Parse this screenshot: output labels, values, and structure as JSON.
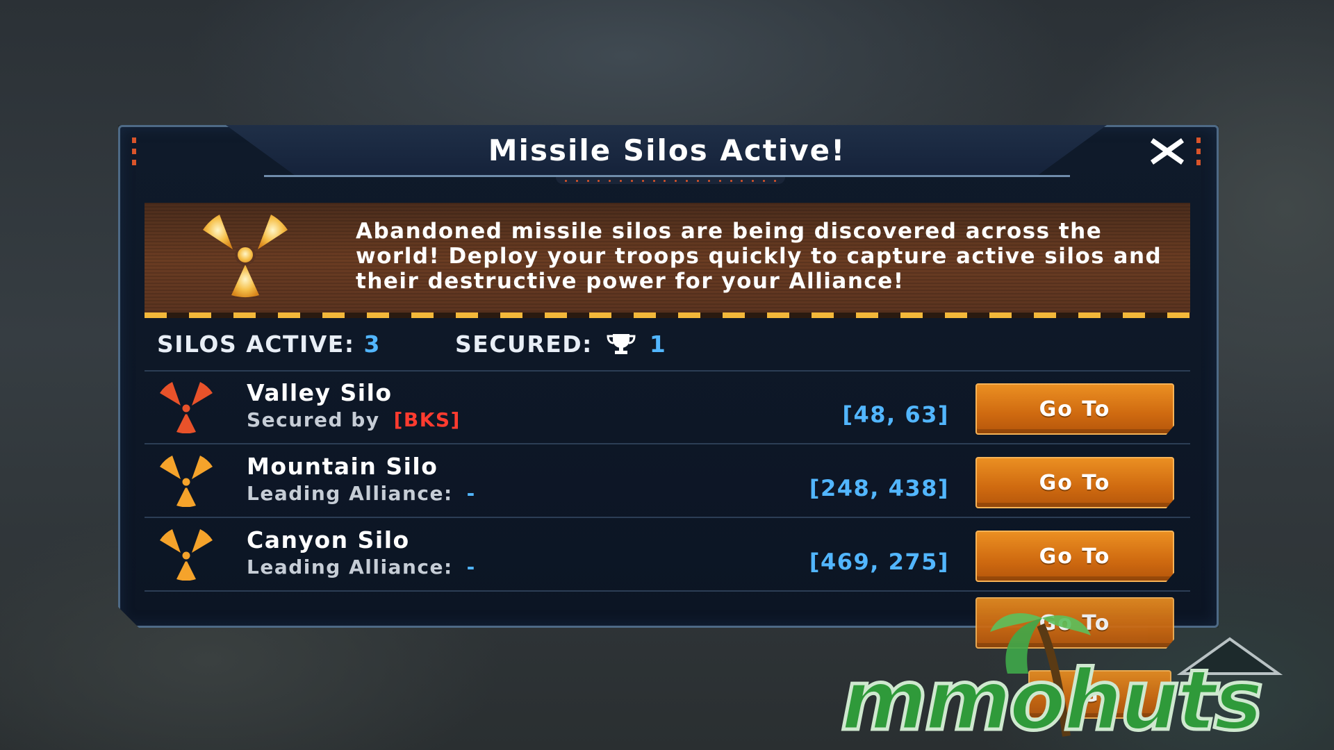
{
  "dialog": {
    "title": "Missile Silos Active!",
    "description": "Abandoned missile silos are being discovered across the world! Deploy your troops quickly to capture active silos and their destructive power for your Alliance!",
    "close_icon": "close-x-icon"
  },
  "stats": {
    "silos_active_label": "SILOS ACTIVE:",
    "silos_active_value": "3",
    "secured_label": "SECURED:",
    "secured_value": "1",
    "secured_icon": "trophy-icon"
  },
  "silos": [
    {
      "name": "Valley Silo",
      "sub_label": "Secured by",
      "sub_value": "[BKS]",
      "coords": "[48, 63]",
      "button": "Go To",
      "icon_color": "#e8522a",
      "value_color": "#ff3b2f"
    },
    {
      "name": "Mountain Silo",
      "sub_label": "Leading Alliance:",
      "sub_value": "-",
      "coords": "[248, 438]",
      "button": "Go To",
      "icon_color": "#f5a32b",
      "value_color": "#52b6ff"
    },
    {
      "name": "Canyon Silo",
      "sub_label": "Leading Alliance:",
      "sub_value": "-",
      "coords": "[469, 275]",
      "button": "Go To",
      "icon_color": "#f5a32b",
      "value_color": "#52b6ff"
    }
  ],
  "extra_buttons": [
    "Go To",
    "Go"
  ],
  "watermark": {
    "text": "mmohuts"
  },
  "colors": {
    "accent_blue": "#52b6ff",
    "button_orange": "#e07a1a",
    "alert_red": "#ff3b2f",
    "hazard_yellow": "#f3b83a"
  }
}
